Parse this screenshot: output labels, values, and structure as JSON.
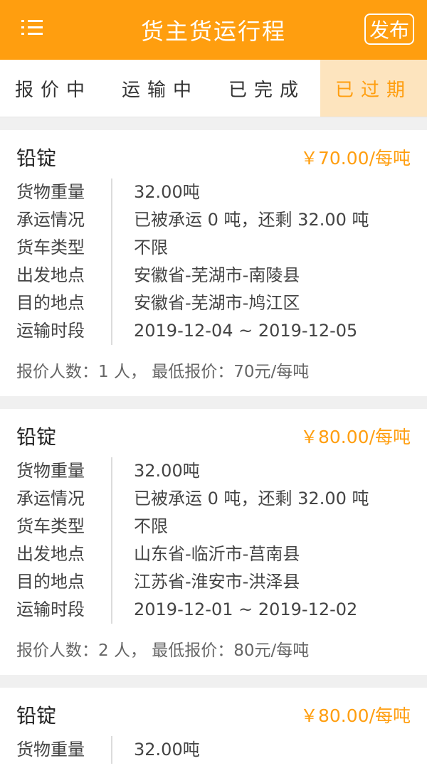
{
  "header": {
    "title": "货主货运行程",
    "publish_label": "发布"
  },
  "tabs": [
    {
      "label": "报价中",
      "active": false
    },
    {
      "label": "运输中",
      "active": false
    },
    {
      "label": "已完成",
      "active": false
    },
    {
      "label": "已过期",
      "active": true
    }
  ],
  "field_labels": [
    "货物重量",
    "承运情况",
    "货车类型",
    "出发地点",
    "目的地点",
    "运输时段"
  ],
  "orders": [
    {
      "goods": "铅锭",
      "price": "￥70.00/每吨",
      "values": [
        "32.00吨",
        "已被承运 0 吨，还剩 32.00 吨",
        "不限",
        "安徽省-芜湖市-南陵县",
        "安徽省-芜湖市-鸠江区",
        "2019-12-04 ~ 2019-12-05"
      ],
      "summary": "报价人数：1 人， 最低报价：70元/每吨"
    },
    {
      "goods": "铅锭",
      "price": "￥80.00/每吨",
      "values": [
        "32.00吨",
        "已被承运 0 吨，还剩 32.00 吨",
        "不限",
        "山东省-临沂市-莒南县",
        "江苏省-淮安市-洪泽县",
        "2019-12-01 ~ 2019-12-02"
      ],
      "summary": "报价人数：2 人， 最低报价：80元/每吨"
    },
    {
      "goods": "铅锭",
      "price": "￥80.00/每吨",
      "values": [
        "32.00吨"
      ],
      "summary": ""
    }
  ],
  "colors": {
    "accent": "#ff9e0f",
    "active_tab_bg": "#fde4be"
  }
}
